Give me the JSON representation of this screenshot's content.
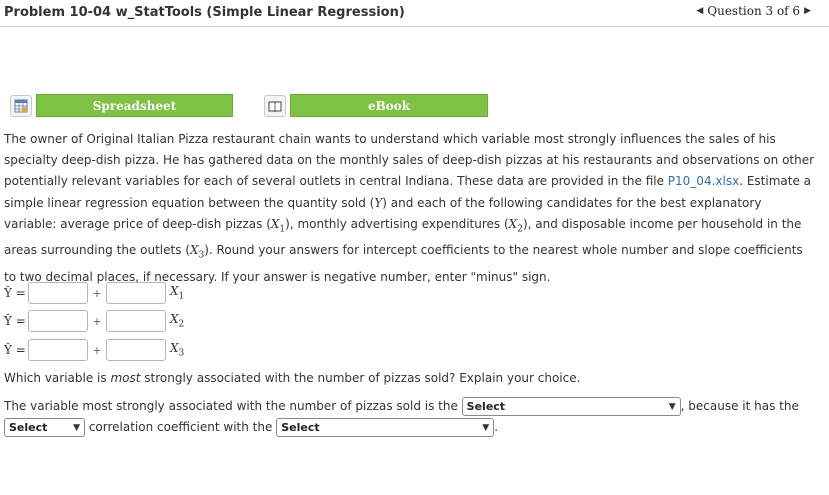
{
  "header": {
    "title": "Problem 10-04 w_StatTools (Simple Linear Regression)",
    "question_nav": "Question 3 of 6"
  },
  "resources": {
    "spreadsheet_label": "Spreadsheet",
    "ebook_label": "eBook"
  },
  "problem": {
    "text_1": "The owner of Original Italian Pizza restaurant chain wants to understand which variable most strongly influences the sales of his specialty deep-dish pizza. He has gathered data on the monthly sales of deep-dish pizzas at his restaurants and observations on other potentially relevant variables for each of several outlets in central Indiana. These data are provided in the file ",
    "file_link": "P10_04.xlsx",
    "text_2": ". Estimate a simple linear regression equation between the quantity sold (",
    "y": "Y",
    "text_3": ") and each of the following candidates for the best explanatory variable: average price of deep-dish pizzas (",
    "x1": "X",
    "text_4": "), monthly advertising expenditures (",
    "text_5": "), and disposable income per household in the areas surrounding the outlets (",
    "text_6": "). Round your answers for intercept coefficients to the nearest whole number and slope coefficients to two decimal places, if necessary. If your answer is negative number, enter \"minus\" sign."
  },
  "equations": [
    {
      "yhat": "Ŷ =",
      "plus": "+",
      "var": "X",
      "sub": "1"
    },
    {
      "yhat": "Ŷ =",
      "plus": "+",
      "var": "X",
      "sub": "2"
    },
    {
      "yhat": "Ŷ =",
      "plus": "+",
      "var": "X",
      "sub": "3"
    }
  ],
  "question2": {
    "pre": "Which variable is ",
    "em": "most",
    "post": " strongly associated with the number of pizzas sold? Explain your choice."
  },
  "answer_line": {
    "text_1": "The variable most strongly associated with the number of pizzas sold is the",
    "select1": "Select",
    "text_2": ", because it has the",
    "select2": "Select",
    "text_3": "correlation coefficient with the",
    "select3": "Select",
    "text_4": "."
  }
}
